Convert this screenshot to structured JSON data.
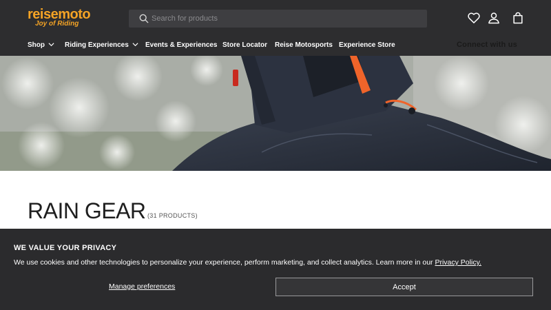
{
  "brand": {
    "logo_text_a": "reise",
    "logo_text_b": "moto",
    "tagline": "Joy of Riding",
    "accent_color": "#f4a325"
  },
  "search": {
    "placeholder": "Search for products",
    "value": "",
    "icon": "search-icon"
  },
  "header_icons": [
    "heart-icon",
    "user-icon",
    "bag-icon"
  ],
  "nav": {
    "items": [
      {
        "label": "Shop",
        "has_dropdown": true
      },
      {
        "label": "Riding Experiences",
        "has_dropdown": true
      },
      {
        "label": "Events & Experiences",
        "has_dropdown": false
      },
      {
        "label": "Store Locator",
        "has_dropdown": false
      },
      {
        "label": "Reise Motosports",
        "has_dropdown": false
      },
      {
        "label": "Experience Store",
        "has_dropdown": false
      }
    ],
    "connect_label": "Connect with us"
  },
  "collection": {
    "title": "RAIN GEAR",
    "count_label": "(31 PRODUCTS)"
  },
  "cookie_banner": {
    "title": "WE VALUE YOUR PRIVACY",
    "text": "We use cookies and other technologies to personalize your experience, perform marketing, and collect analytics. Learn more in our ",
    "policy_link": "Privacy Policy.",
    "manage_label": "Manage preferences",
    "accept_label": "Accept"
  }
}
